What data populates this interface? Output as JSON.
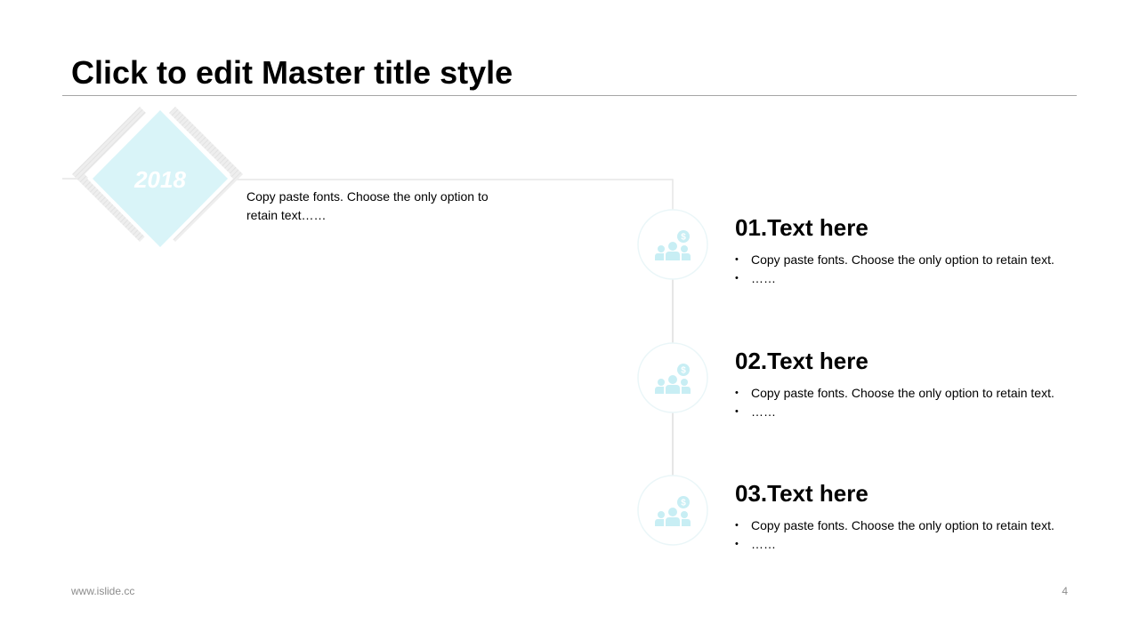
{
  "slide": {
    "title": "Click to edit Master title style",
    "footer_url": "www.islide.cc",
    "page_number": "4"
  },
  "colors": {
    "accent": "#d9f4f8",
    "icon": "#c8eef4",
    "line": "#e6e6e6",
    "rule": "#a6a6a6",
    "footer_text": "#8c8c8c"
  },
  "timeline": {
    "year": "2018",
    "intro_text": "Copy paste fonts. Choose the only option to retain text……",
    "items": [
      {
        "heading": "01.Text here",
        "icon": "people-money-icon",
        "bullets": [
          "Copy paste fonts. Choose the only option to retain text.",
          "……"
        ]
      },
      {
        "heading": "02.Text here",
        "icon": "people-money-icon",
        "bullets": [
          "Copy paste fonts. Choose the only option to retain text.",
          "……"
        ]
      },
      {
        "heading": "03.Text here",
        "icon": "people-money-icon",
        "bullets": [
          "Copy paste fonts. Choose the only option to retain text.",
          "……"
        ]
      }
    ]
  }
}
